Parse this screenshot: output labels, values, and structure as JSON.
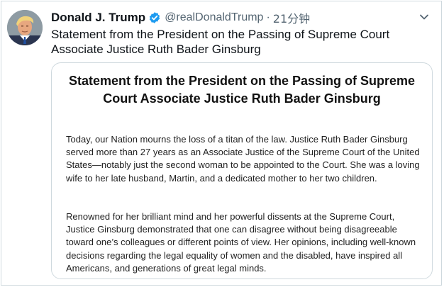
{
  "tweet": {
    "display_name": "Donald J. Trump",
    "handle": "@realDonaldTrump",
    "separator": "·",
    "time": "21分钟",
    "text": "Statement from the President on the Passing of Supreme Court Associate Justice Ruth Bader Ginsburg"
  },
  "statement": {
    "title": "Statement from the President on the Passing of Supreme Court Associate Justice Ruth Bader Ginsburg",
    "paragraphs": [
      "Today, our Nation mourns the loss of a titan of the law. Justice Ruth Bader Ginsburg served more than 27 years as an Associate Justice of the Supreme Court of the United States—notably just the second woman to be appointed to the Court. She was a loving wife to her late husband, Martin, and a dedicated mother to her two children.",
      "Renowned for her brilliant mind and her powerful dissents at the Supreme Court, Justice Ginsburg demonstrated that one can disagree without being disagreeable toward one’s colleagues or different points of view. Her opinions, including well-known decisions regarding the legal equality of women and the disabled, have inspired all Americans, and generations of great legal minds."
    ]
  },
  "icons": {
    "verified": "verified-badge-icon",
    "menu": "chevron-down-icon"
  },
  "colors": {
    "verified_blue": "#1d9bf0",
    "secondary_text": "#536471",
    "border": "#cfd9de"
  }
}
